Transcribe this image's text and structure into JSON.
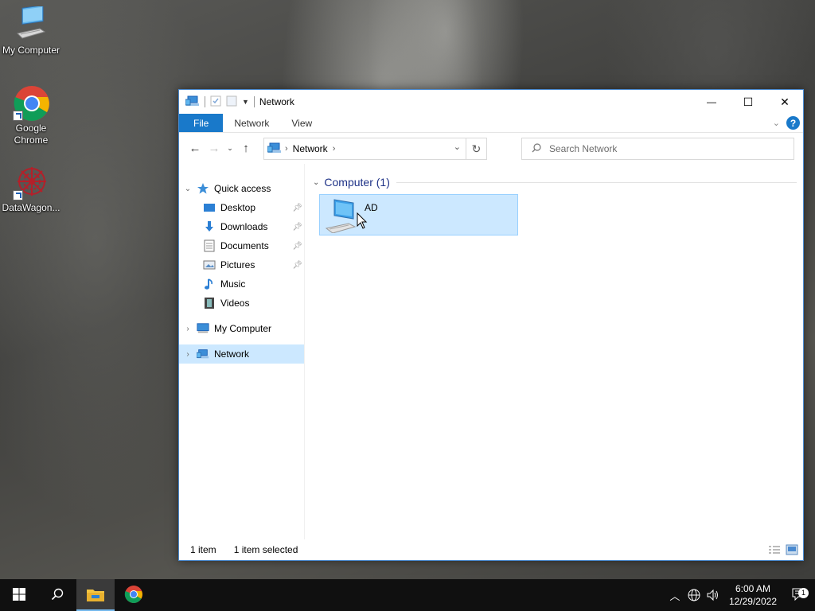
{
  "desktop": {
    "icons": [
      {
        "label": "My Computer",
        "icon": "computer-icon"
      },
      {
        "label": "Google Chrome",
        "icon": "chrome-icon"
      },
      {
        "label": "DataWagon...",
        "icon": "datawagon-icon"
      }
    ]
  },
  "window": {
    "title": "Network",
    "controls": {
      "minimize": "—",
      "maximize": "☐",
      "close": "✕"
    },
    "ribbon": {
      "tabs": [
        {
          "label": "File"
        },
        {
          "label": "Network"
        },
        {
          "label": "View"
        }
      ],
      "help": "?"
    },
    "address": {
      "crumb": "Network",
      "placeholder": "Search Network"
    },
    "tree": {
      "quick_access": "Quick access",
      "items": [
        {
          "label": "Desktop",
          "icon": "desktop-folder-icon",
          "pinned": true
        },
        {
          "label": "Downloads",
          "icon": "downloads-icon",
          "pinned": true
        },
        {
          "label": "Documents",
          "icon": "documents-icon",
          "pinned": true
        },
        {
          "label": "Pictures",
          "icon": "pictures-icon",
          "pinned": true
        },
        {
          "label": "Music",
          "icon": "music-icon",
          "pinned": false
        },
        {
          "label": "Videos",
          "icon": "videos-icon",
          "pinned": false
        }
      ],
      "my_computer": "My Computer",
      "network": "Network"
    },
    "main": {
      "group_header": "Computer (1)",
      "items": [
        {
          "name": "AD",
          "icon": "computer-icon",
          "selected": true
        }
      ]
    },
    "status": {
      "count": "1 item",
      "selection": "1 item selected"
    }
  },
  "taskbar": {
    "clock": {
      "time": "6:00 AM",
      "date": "12/29/2022"
    },
    "notification_count": "1"
  },
  "colors": {
    "accent": "#1979ca",
    "selection": "#cce8ff",
    "group_header": "#1e3287"
  }
}
